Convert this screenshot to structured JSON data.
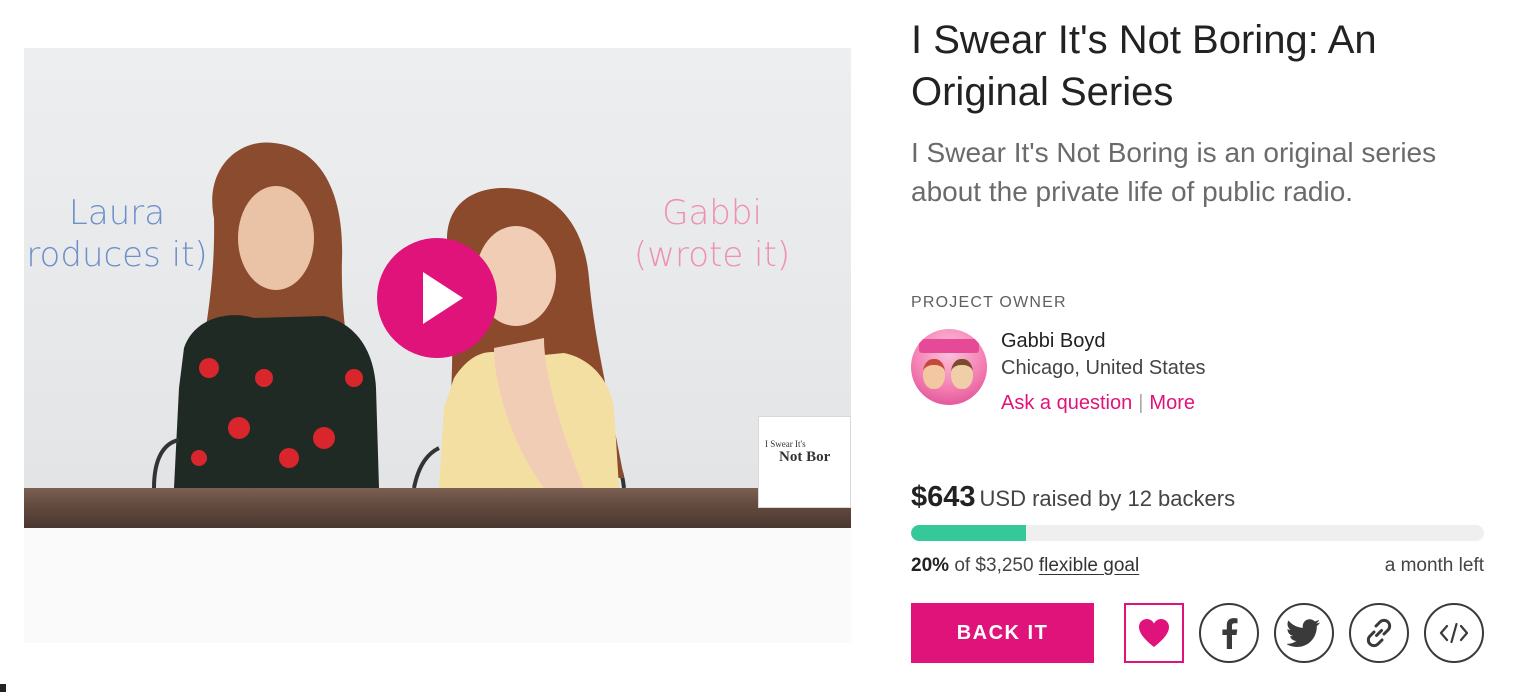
{
  "video": {
    "left_caption": [
      "Laura",
      "roduces it)"
    ],
    "right_caption": [
      "Gabbi",
      "(wrote it)"
    ],
    "name_card": [
      "I Swear It's",
      "Not Bor"
    ],
    "play_label": "Play video"
  },
  "project": {
    "title": "I Swear It's Not Boring: An Original Series",
    "blurb": "I Swear It's Not Boring is an original series about the private life of public radio."
  },
  "owner": {
    "heading": "PROJECT OWNER",
    "name": "Gabbi Boyd",
    "location": "Chicago, United States",
    "ask_label": "Ask a question",
    "separator": "|",
    "more_label": "More"
  },
  "funding": {
    "amount": "$643",
    "summary": "USD raised by 12 backers",
    "percent": "20%",
    "of_text": "of $3,250",
    "goal_type": "flexible goal",
    "time_left": "a month left",
    "progress_fraction": 0.2
  },
  "actions": {
    "back_label": "BACK IT",
    "favorite_icon": "heart-icon",
    "share_icons": [
      "facebook-icon",
      "twitter-icon",
      "link-icon",
      "embed-icon"
    ]
  },
  "colors": {
    "brand": "#e0137a",
    "progress": "#35c99a",
    "track": "#efefef"
  }
}
